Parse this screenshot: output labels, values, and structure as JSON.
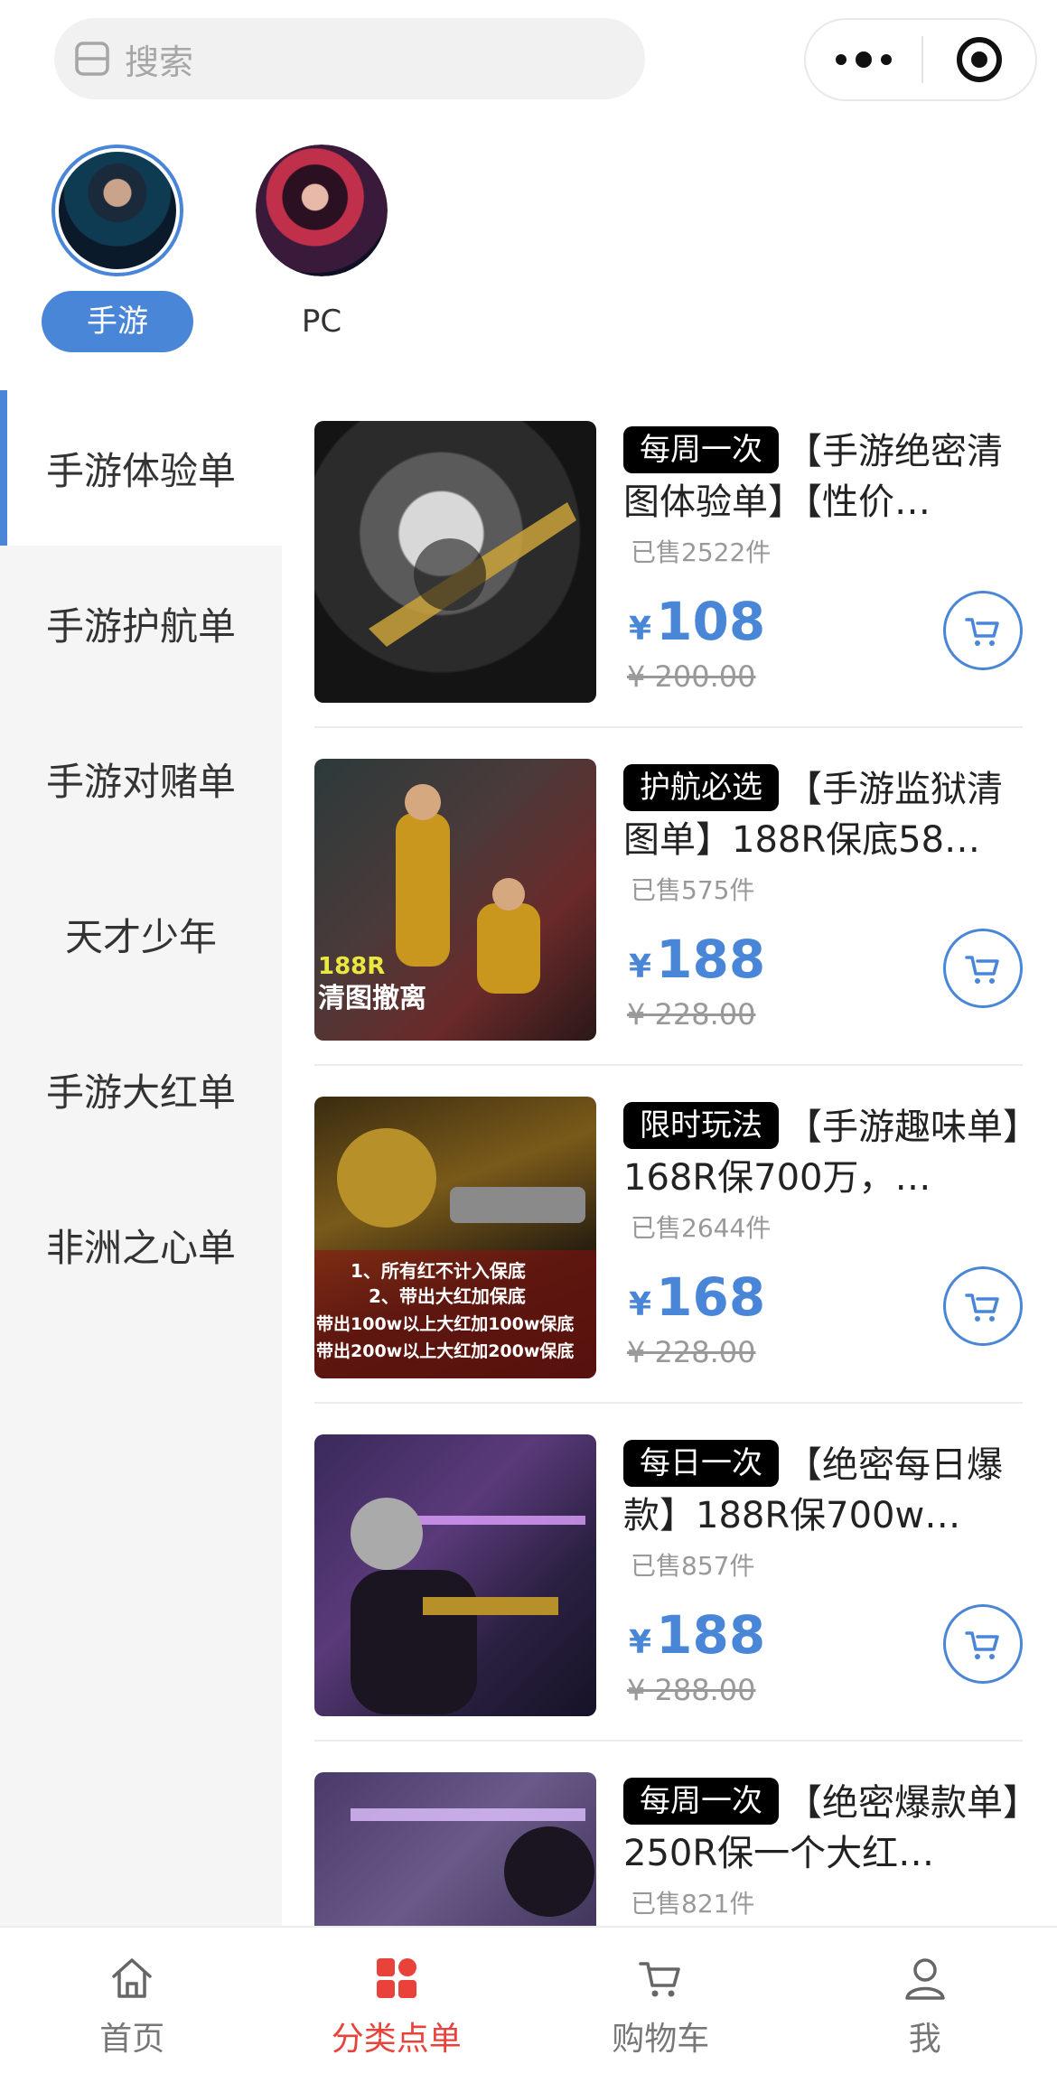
{
  "search": {
    "placeholder": "搜索"
  },
  "categories": [
    {
      "label": "手游",
      "active": true
    },
    {
      "label": "PC",
      "active": false
    }
  ],
  "sidebar": {
    "items": [
      {
        "label": "手游体验单",
        "active": true
      },
      {
        "label": "手游护航单"
      },
      {
        "label": "手游对赌单"
      },
      {
        "label": "天才少年"
      },
      {
        "label": "手游大红单"
      },
      {
        "label": "非洲之心单"
      }
    ]
  },
  "products": [
    {
      "tag": "每周一次",
      "title": "【手游绝密清图体验单】【性价…",
      "sold": "已售2522件",
      "currency": "¥",
      "price": "108",
      "old_price": "¥ 200.00"
    },
    {
      "tag": "护航必选",
      "title": "【手游监狱清图单】188R保底58…",
      "sold": "已售575件",
      "currency": "¥",
      "price": "188",
      "old_price": "¥ 228.00"
    },
    {
      "tag": "限时玩法",
      "title": "【手游趣味单】168R保700万，…",
      "sold": "已售2644件",
      "currency": "¥",
      "price": "168",
      "old_price": "¥ 228.00"
    },
    {
      "tag": "每日一次",
      "title": "【绝密每日爆款】188R保700w…",
      "sold": "已售857件",
      "currency": "¥",
      "price": "188",
      "old_price": "¥ 288.00"
    },
    {
      "tag": "每周一次",
      "title": "【绝密爆款单】250R保一个大红…",
      "sold": "已售821件"
    }
  ],
  "bottom_nav": [
    {
      "label": "首页",
      "icon": "home-icon"
    },
    {
      "label": "分类点单",
      "icon": "category-icon",
      "active": true
    },
    {
      "label": "购物车",
      "icon": "cart-icon"
    },
    {
      "label": "我",
      "icon": "user-icon"
    }
  ],
  "colors": {
    "accent": "#4a86d8",
    "active_nav": "#e8423a",
    "tag_bg": "#000000"
  }
}
